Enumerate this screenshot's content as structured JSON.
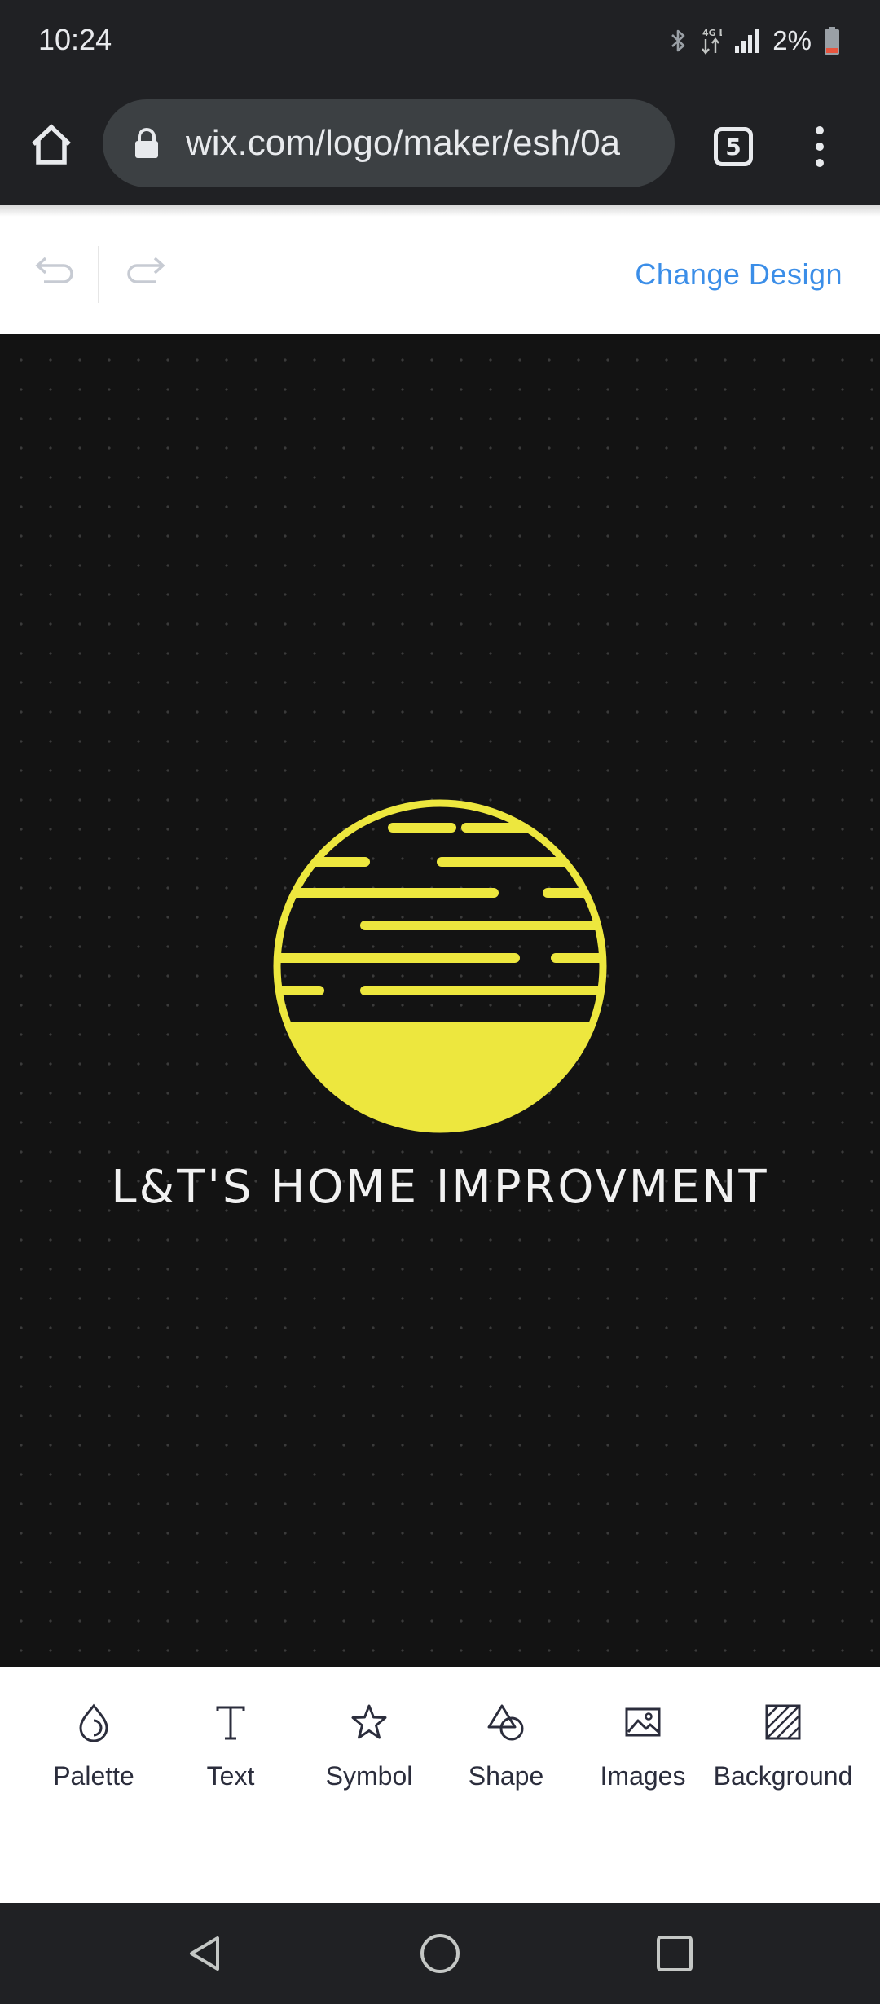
{
  "status_bar": {
    "time": "10:24",
    "network": "4G LTE",
    "battery": "2%",
    "icons": [
      "bluetooth-icon",
      "lte-icon",
      "signal-icon",
      "battery-icon"
    ]
  },
  "browser": {
    "url": "wix.com/logo/maker/esh/0a",
    "tab_count": "5",
    "icons": [
      "home-icon",
      "lock-icon",
      "tabs-icon",
      "more-menu-icon"
    ]
  },
  "editor": {
    "change_design": "Change Design",
    "icons": [
      "undo-icon",
      "redo-icon"
    ]
  },
  "logo": {
    "text": "L&T'S HOME IMPROVMENT",
    "symbol": "striped-sun-circle",
    "symbol_color": "#EDE73E",
    "text_color": "#F1F1F1",
    "background_color": "#131313"
  },
  "tools": [
    {
      "label": "Palette",
      "icon": "palette-drop-icon"
    },
    {
      "label": "Text",
      "icon": "text-icon"
    },
    {
      "label": "Symbol",
      "icon": "star-icon"
    },
    {
      "label": "Shape",
      "icon": "shapes-icon"
    },
    {
      "label": "Images",
      "icon": "image-icon"
    },
    {
      "label": "Background",
      "icon": "background-hatch-icon"
    }
  ],
  "nav": {
    "icons": [
      "back-icon",
      "home-circle-icon",
      "recents-icon"
    ]
  },
  "colors": {
    "accent": "#3B8EE8",
    "chrome_dark": "#202124"
  }
}
